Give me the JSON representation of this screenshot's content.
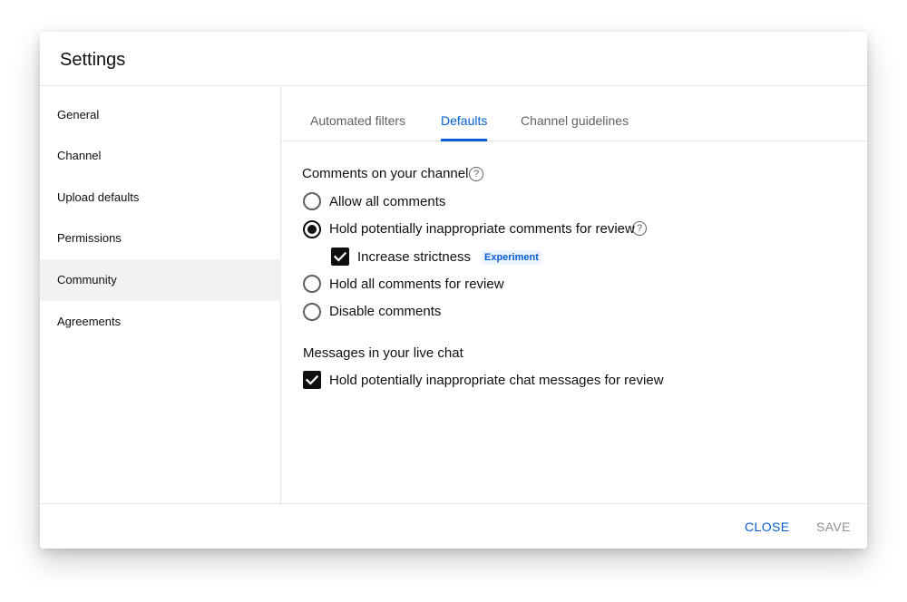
{
  "dialog": {
    "title": "Settings"
  },
  "sidebar": {
    "items": [
      {
        "label": "General"
      },
      {
        "label": "Channel"
      },
      {
        "label": "Upload defaults"
      },
      {
        "label": "Permissions"
      },
      {
        "label": "Community",
        "active": true
      },
      {
        "label": "Agreements"
      }
    ]
  },
  "tabs": [
    {
      "label": "Automated filters"
    },
    {
      "label": "Defaults",
      "active": true
    },
    {
      "label": "Channel guidelines"
    }
  ],
  "comments": {
    "title": "Comments on your channel",
    "options": [
      {
        "label": "Allow all comments",
        "selected": false
      },
      {
        "label": "Hold potentially inappropriate comments for review",
        "selected": true
      },
      {
        "label": "Hold all comments for review",
        "selected": false
      },
      {
        "label": "Disable comments",
        "selected": false
      }
    ],
    "strictness": {
      "label": "Increase strictness",
      "checked": true,
      "badge": "Experiment"
    }
  },
  "live_chat": {
    "title": "Messages in your live chat",
    "option": {
      "label": "Hold potentially inappropriate chat messages for review",
      "checked": true
    }
  },
  "footer": {
    "close_label": "CLOSE",
    "save_label": "SAVE"
  },
  "icons": {
    "help": "help-circle-icon",
    "check": "checkmark-icon"
  },
  "colors": {
    "accent": "#065fd4",
    "active_sidebar_bg": "#f2f2f2",
    "text": "#0f0f0f",
    "secondary_text": "#606060",
    "disabled_text": "#909090"
  }
}
